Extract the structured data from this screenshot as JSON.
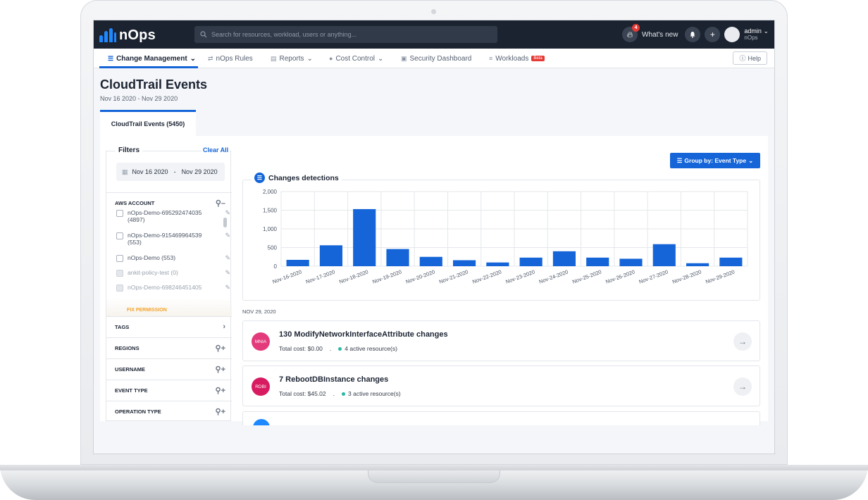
{
  "app": {
    "logo_text": "nOps"
  },
  "topbar": {
    "search_placeholder": "Search for resources, workload, users or anything...",
    "notification_count": "4",
    "whats_new": "What's new",
    "user_name": "admin",
    "user_org": "nOps"
  },
  "nav": {
    "items": [
      {
        "label": "Change Management",
        "icon": "layers-icon",
        "dropdown": true,
        "active": true
      },
      {
        "label": "nOps Rules",
        "icon": "swap-icon"
      },
      {
        "label": "Reports",
        "icon": "document-icon",
        "dropdown": true
      },
      {
        "label": "Cost Control",
        "icon": "coin-icon",
        "dropdown": true
      },
      {
        "label": "Security Dashboard",
        "icon": "lock-icon"
      },
      {
        "label": "Workloads",
        "icon": "stack-icon",
        "badge": "Beta"
      }
    ],
    "help": "Help"
  },
  "page": {
    "title": "CloudTrail Events",
    "date_range": "Nov 16 2020 - Nov 29 2020",
    "tab": "CloudTrail Events (5450)"
  },
  "filters": {
    "title": "Filters",
    "clear_all": "Clear All",
    "date_from": "Nov 16 2020",
    "date_sep": "-",
    "date_to": "Nov 29 2020",
    "aws_account_label": "AWS ACCOUNT",
    "accounts": [
      {
        "name": "nOps-Demo-695292474035",
        "count": "(4897)",
        "disabled": false
      },
      {
        "name": "nOps-Demo-915469964539",
        "count": "(553)",
        "disabled": false
      },
      {
        "name": "nOps-Demo (553)",
        "count": "",
        "disabled": false
      },
      {
        "name": "ankit-policy-test (0)",
        "count": "",
        "disabled": true
      },
      {
        "name": "nOps-Demo-698246451405",
        "count": "",
        "disabled": true
      }
    ],
    "fix_permission": "FIX PERMISSION",
    "sections": [
      "TAGS",
      "REGIONS",
      "USERNAME",
      "EVENT TYPE",
      "OPERATION TYPE"
    ]
  },
  "group_by": "Group by: Event Type",
  "chart_data": {
    "type": "bar",
    "title": "Changes detections",
    "categories": [
      "Nov-16-2020",
      "Nov-17-2020",
      "Nov-18-2020",
      "Nov-19-2020",
      "Nov-20-2020",
      "Nov-21-2020",
      "Nov-22-2020",
      "Nov-23-2020",
      "Nov-24-2020",
      "Nov-25-2020",
      "Nov-26-2020",
      "Nov-27-2020",
      "Nov-28-2020",
      "Nov-29-2020"
    ],
    "values": [
      170,
      560,
      1530,
      460,
      250,
      160,
      100,
      230,
      400,
      230,
      200,
      590,
      80,
      230
    ],
    "ylim": [
      0,
      2000
    ],
    "yticks": [
      "0",
      "500",
      "1,000",
      "1,500",
      "2,000"
    ],
    "color": "#1565d8",
    "grid": true
  },
  "events": {
    "date_group": "NOV 29, 2020",
    "items": [
      {
        "badge": "MNIA",
        "badge_color": "#e23a7a",
        "title": "130 ModifyNetworkInterfaceAttribute changes",
        "cost": "Total cost: $0.00",
        "sep": ".",
        "resources": "4 active resource(s)"
      },
      {
        "badge": "RDBI",
        "badge_color": "#d81b60",
        "title": "7 RebootDBInstance changes",
        "cost": "Total cost: $45.02",
        "sep": ".",
        "resources": "3 active resource(s)"
      }
    ]
  }
}
